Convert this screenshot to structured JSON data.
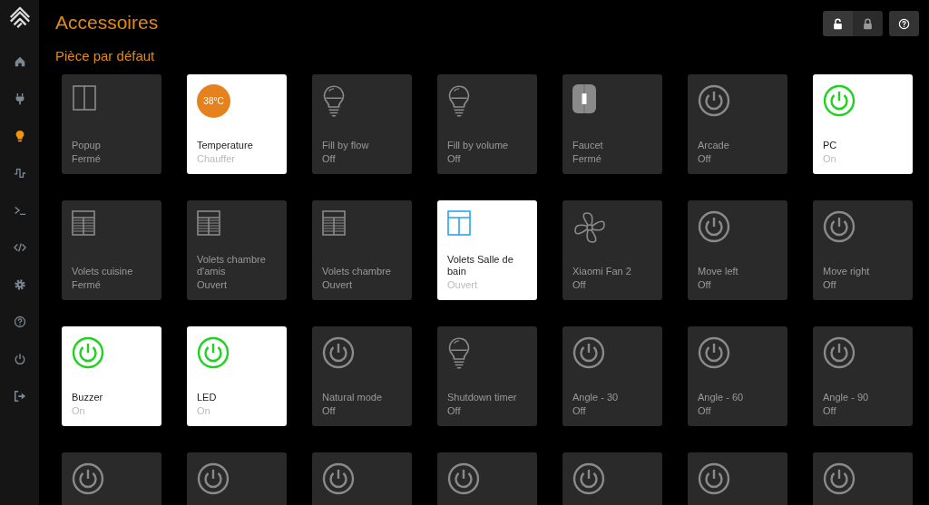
{
  "sidebar": {
    "items": [
      {
        "kind": "home",
        "selected": false
      },
      {
        "kind": "plug",
        "selected": false
      },
      {
        "kind": "bulb",
        "selected": true
      },
      {
        "kind": "pulse",
        "selected": false
      },
      {
        "kind": "terminal",
        "selected": false
      },
      {
        "kind": "code",
        "selected": false
      },
      {
        "kind": "gear",
        "selected": false
      },
      {
        "kind": "help",
        "selected": false
      },
      {
        "kind": "power",
        "selected": false
      },
      {
        "kind": "logout",
        "selected": false
      }
    ]
  },
  "header": {
    "title": "Accessoires",
    "buttons": [
      {
        "kind": "unlock",
        "selected": true
      },
      {
        "kind": "lock",
        "selected": false
      },
      {
        "kind": "help"
      }
    ]
  },
  "section": {
    "title": "Pièce par défaut"
  },
  "tiles": [
    {
      "kind": "window",
      "on": false,
      "name": "Popup",
      "status": "Fermé"
    },
    {
      "kind": "thermo",
      "on": true,
      "reading": "38°C",
      "name": "Temperature",
      "status": "Chauffer"
    },
    {
      "kind": "bulb",
      "on": false,
      "name": "Fill by flow",
      "status": "Off"
    },
    {
      "kind": "bulb",
      "on": false,
      "name": "Fill by volume",
      "status": "Off"
    },
    {
      "kind": "faucet",
      "on": false,
      "name": "Faucet",
      "status": "Fermé"
    },
    {
      "kind": "power",
      "on": false,
      "name": "Arcade",
      "status": "Off"
    },
    {
      "kind": "power",
      "on": true,
      "name": "PC",
      "status": "On"
    },
    {
      "kind": "blinds",
      "on": false,
      "name": "Volets cuisine",
      "status": "Fermé"
    },
    {
      "kind": "blinds",
      "on": false,
      "name": "Volets chambre d'amis",
      "status": "Ouvert"
    },
    {
      "kind": "blinds",
      "on": false,
      "name": "Volets chambre",
      "status": "Ouvert"
    },
    {
      "kind": "blinds",
      "on": true,
      "name": "Volets Salle de bain",
      "status": "Ouvert"
    },
    {
      "kind": "fan",
      "on": false,
      "name": "Xiaomi Fan 2",
      "status": "Off"
    },
    {
      "kind": "power",
      "on": false,
      "name": "Move left",
      "status": "Off"
    },
    {
      "kind": "power",
      "on": false,
      "name": "Move right",
      "status": "Off"
    },
    {
      "kind": "power",
      "on": true,
      "name": "Buzzer",
      "status": "On"
    },
    {
      "kind": "power",
      "on": true,
      "name": "LED",
      "status": "On"
    },
    {
      "kind": "power",
      "on": false,
      "name": "Natural mode",
      "status": "Off"
    },
    {
      "kind": "bulb",
      "on": false,
      "name": "Shutdown timer",
      "status": "Off"
    },
    {
      "kind": "power",
      "on": false,
      "name": "Angle - 30",
      "status": "Off"
    },
    {
      "kind": "power",
      "on": false,
      "name": "Angle - 60",
      "status": "Off"
    },
    {
      "kind": "power",
      "on": false,
      "name": "Angle - 90",
      "status": "Off"
    },
    {
      "kind": "power",
      "on": false
    },
    {
      "kind": "power",
      "on": false
    },
    {
      "kind": "power",
      "on": false
    },
    {
      "kind": "power",
      "on": false
    },
    {
      "kind": "power",
      "on": false
    },
    {
      "kind": "power",
      "on": false
    },
    {
      "kind": "power",
      "on": false
    }
  ]
}
